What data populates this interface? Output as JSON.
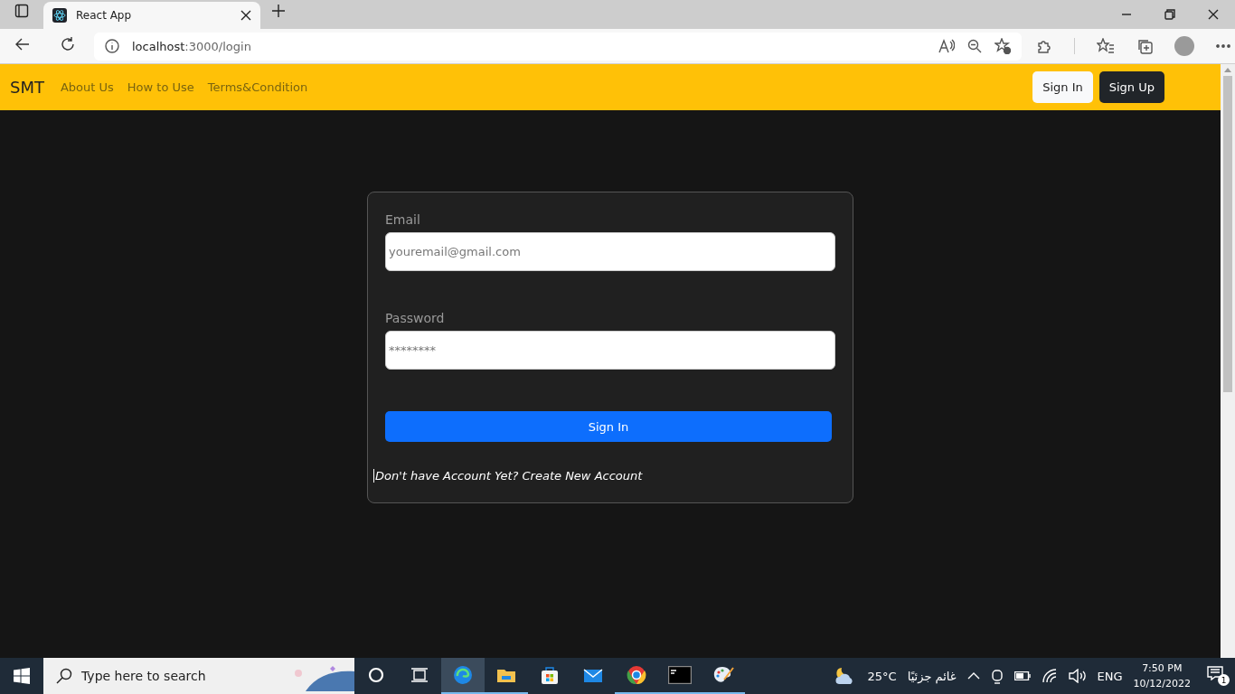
{
  "browser": {
    "tab": {
      "title": "React App",
      "selected": true
    },
    "address": {
      "host": "localhost",
      "path": ":3000/login"
    }
  },
  "navbar": {
    "brand": "SMT",
    "links": [
      "About Us",
      "How to Use",
      "Terms&Condition"
    ],
    "buttons": [
      {
        "label": "Sign In",
        "kind": "light"
      },
      {
        "label": "Sign Up",
        "kind": "dark"
      }
    ]
  },
  "login_form": {
    "fields": [
      {
        "label": "Email",
        "placeholder": "youremail@gmail.com"
      },
      {
        "label": "Password",
        "placeholder": "********"
      }
    ],
    "submit": "Sign In",
    "footer": "Don't have Account Yet? Create New Account"
  },
  "taskbar": {
    "search_placeholder": "Type here to search",
    "apps": [
      {
        "kind": "edge",
        "selected": true,
        "running": true
      },
      {
        "kind": "files",
        "selected": false,
        "running": true
      },
      {
        "kind": "store",
        "selected": false,
        "running": false
      },
      {
        "kind": "mail",
        "selected": false,
        "running": false
      },
      {
        "kind": "chrome",
        "selected": false,
        "running": true
      },
      {
        "kind": "terminal",
        "selected": false,
        "running": true
      },
      {
        "kind": "paint",
        "selected": false,
        "running": true
      }
    ],
    "weather": {
      "temperature": "25°C",
      "condition": "غائم جزئيًا"
    },
    "language": "ENG",
    "time": "7:50 PM",
    "date": "10/12/2022",
    "notifications": "1"
  }
}
